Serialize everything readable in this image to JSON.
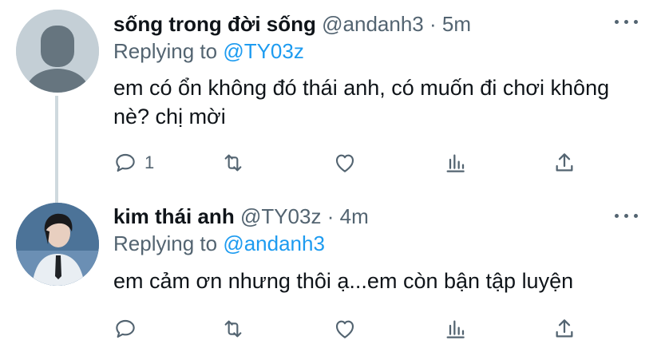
{
  "tweets": [
    {
      "display_name": "sống trong đời sống",
      "handle": "@andanh3",
      "separator": "·",
      "time": "5m",
      "replying_label": "Replying to",
      "replying_to": "@TY03z",
      "text": "em có ổn không đó thái anh, có muốn đi chơi không nè? chị mời",
      "reply_count": "1",
      "retweet_count": "",
      "like_count": "",
      "avatar": "default-avatar-icon"
    },
    {
      "display_name": "kim thái anh",
      "handle": "@TY03z",
      "separator": "·",
      "time": "4m",
      "replying_label": "Replying to",
      "replying_to": "@andanh3",
      "text": "em cảm ơn nhưng thôi ạ...em còn bận tập luyện",
      "reply_count": "",
      "retweet_count": "",
      "like_count": "",
      "avatar": "profile-photo"
    }
  ],
  "colors": {
    "text": "#0f1419",
    "secondary": "#536471",
    "accent": "#1d9bf0",
    "thread_line": "#cfd9de"
  },
  "icons": [
    "reply-icon",
    "retweet-icon",
    "like-icon",
    "analytics-icon",
    "share-icon",
    "more-icon"
  ]
}
